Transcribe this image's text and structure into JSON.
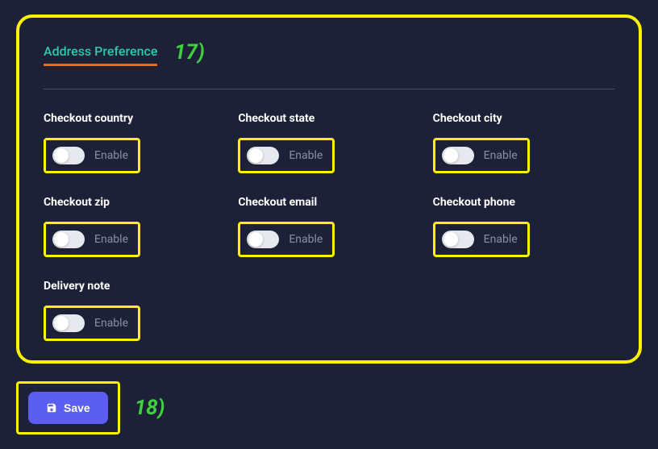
{
  "annotations": {
    "panel": "17)",
    "save": "18)"
  },
  "section": {
    "title": "Address Preference"
  },
  "fields": [
    {
      "label": "Checkout country",
      "toggle_text": "Enable"
    },
    {
      "label": "Checkout state",
      "toggle_text": "Enable"
    },
    {
      "label": "Checkout city",
      "toggle_text": "Enable"
    },
    {
      "label": "Checkout zip",
      "toggle_text": "Enable"
    },
    {
      "label": "Checkout email",
      "toggle_text": "Enable"
    },
    {
      "label": "Checkout phone",
      "toggle_text": "Enable"
    },
    {
      "label": "Delivery note",
      "toggle_text": "Enable"
    }
  ],
  "actions": {
    "save_label": "Save"
  }
}
